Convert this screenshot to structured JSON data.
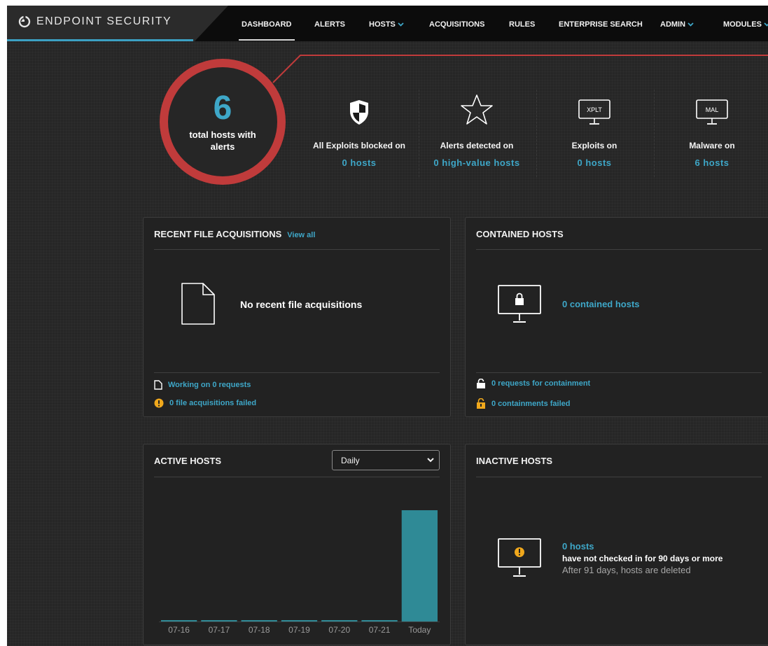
{
  "brand": {
    "name": "ENDPOINT SECURITY",
    "accent": "#3ca0c3"
  },
  "nav": {
    "items": [
      {
        "label": "DASHBOARD",
        "active": true
      },
      {
        "label": "ALERTS"
      },
      {
        "label": "HOSTS",
        "dropdown": true
      },
      {
        "label": "ACQUISITIONS"
      },
      {
        "label": "RULES"
      },
      {
        "label": "ENTERPRISE SEARCH"
      },
      {
        "label": "ADMIN",
        "dropdown": true
      },
      {
        "label": "MODULES",
        "dropdown": true
      }
    ]
  },
  "summary": {
    "total_hosts": "6",
    "total_label": "total hosts with alerts",
    "ring_color": "#c03b3b",
    "stats": [
      {
        "icon": "shield-icon",
        "label": "All Exploits blocked on",
        "value": "0  hosts"
      },
      {
        "icon": "star-icon",
        "label": "Alerts detected on",
        "value": "0  high-value hosts"
      },
      {
        "icon": "xplt-monitor-icon",
        "icon_text": "XPLT",
        "label": "Exploits on",
        "value": "0  hosts"
      },
      {
        "icon": "mal-monitor-icon",
        "icon_text": "MAL",
        "label": "Malware on",
        "value": "6  hosts"
      }
    ]
  },
  "acquisitions": {
    "title": "RECENT FILE ACQUISITIONS",
    "view_all": "View all",
    "empty_message": "No recent file acquisitions",
    "working": "Working on 0 requests",
    "failed": "0 file acquisitions failed"
  },
  "contained": {
    "title": "CONTAINED HOSTS",
    "count_text": "0 contained hosts",
    "requests": "0 requests for containment",
    "failed": "0 containments failed"
  },
  "active_hosts": {
    "title": "ACTIVE HOSTS",
    "range_selected": "Daily",
    "range_options": [
      "Daily"
    ]
  },
  "inactive": {
    "title": "INACTIVE HOSTS",
    "count": "0 hosts",
    "message": "have not checked in for 90 days or more",
    "note": "After 91 days, hosts are deleted"
  },
  "chart_data": {
    "type": "bar",
    "categories": [
      "07-16",
      "07-17",
      "07-18",
      "07-19",
      "07-20",
      "07-21",
      "Today"
    ],
    "values": [
      0,
      0,
      0,
      0,
      0,
      0,
      6
    ],
    "ylim": [
      0,
      6
    ],
    "bar_color": "#2f8a96",
    "grid": false
  }
}
